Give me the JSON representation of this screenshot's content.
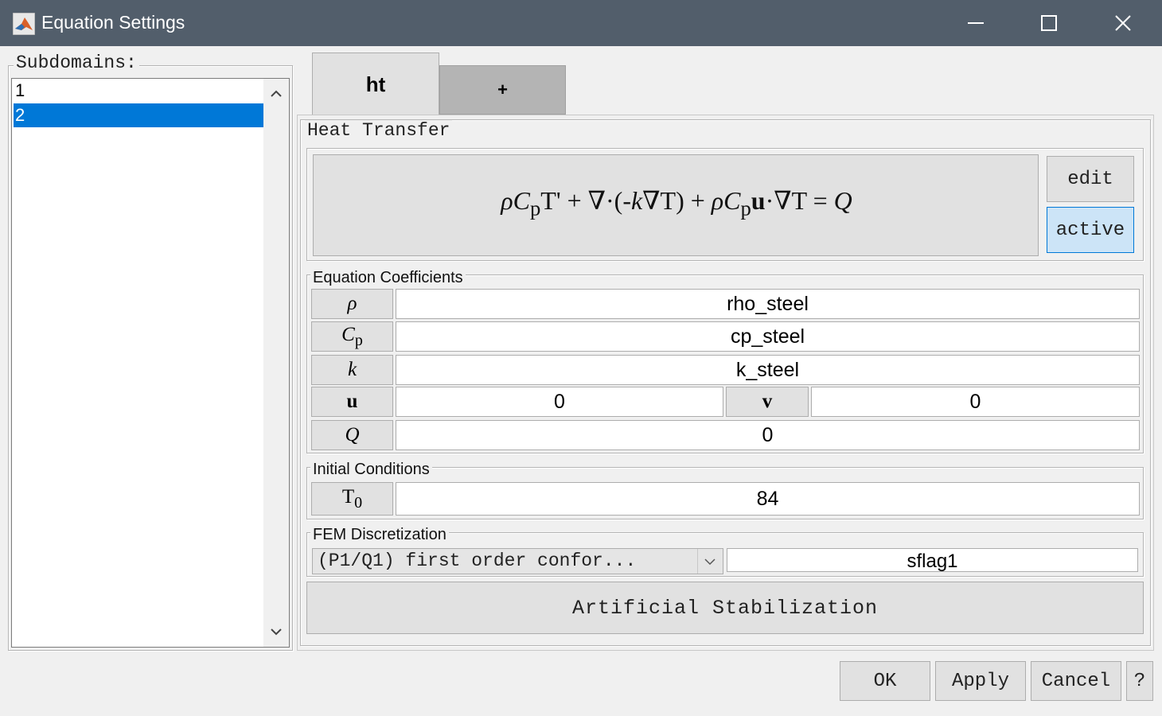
{
  "window": {
    "title": "Equation Settings",
    "minimize_icon": "minimize-icon",
    "maximize_icon": "maximize-icon",
    "close_icon": "close-icon"
  },
  "subdomains": {
    "label": "Subdomains:",
    "items": [
      "1",
      "2"
    ],
    "selected": "2"
  },
  "tabs": [
    {
      "label": "ht",
      "active": true
    },
    {
      "label": "+",
      "active": false
    }
  ],
  "heat_transfer": {
    "title": "Heat Transfer",
    "edit_label": "edit",
    "active_label": "active"
  },
  "coefficients": {
    "title": "Equation Coefficients",
    "rows": [
      {
        "value": "rho_steel"
      },
      {
        "value": "cp_steel"
      },
      {
        "value": "k_steel"
      },
      {
        "value": "0",
        "value2": "0"
      },
      {
        "value": "0"
      }
    ]
  },
  "initial_conditions": {
    "title": "Initial Conditions",
    "value": "84"
  },
  "fem": {
    "title": "FEM Discretization",
    "selected_option": "(P1/Q1) first order confor...",
    "flag_value": "sflag1"
  },
  "stabilization_label": "Artificial Stabilization",
  "footer": {
    "ok": "OK",
    "apply": "Apply",
    "cancel": "Cancel",
    "help": "?"
  },
  "colors": {
    "titlebar": "#525e6b",
    "selection": "#0078d7",
    "active_button": "#cce4f7"
  }
}
